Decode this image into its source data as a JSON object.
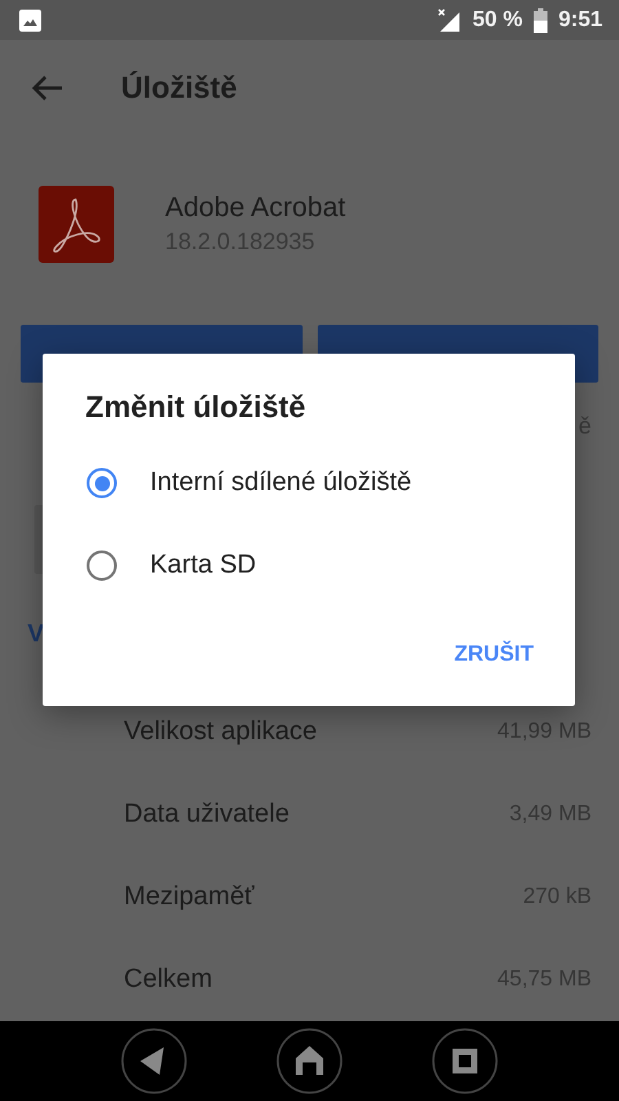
{
  "status_bar": {
    "battery": "50 %",
    "time": "9:51"
  },
  "toolbar": {
    "title": "Úložiště"
  },
  "app": {
    "name": "Adobe Acrobat",
    "version": "18.2.0.182935"
  },
  "covered": {
    "right_fragment": "ě",
    "left_fragment": "V"
  },
  "storage_rows": [
    {
      "label": "Velikost aplikace",
      "value": "41,99 MB"
    },
    {
      "label": "Data uživatele",
      "value": "3,49 MB"
    },
    {
      "label": "Mezipaměť",
      "value": "270 kB"
    },
    {
      "label": "Celkem",
      "value": "45,75 MB"
    }
  ],
  "dialog": {
    "title": "Změnit úložiště",
    "options": [
      {
        "label": "Interní sdílené úložiště",
        "selected": true
      },
      {
        "label": "Karta SD",
        "selected": false
      }
    ],
    "cancel": "ZRUŠIT"
  }
}
